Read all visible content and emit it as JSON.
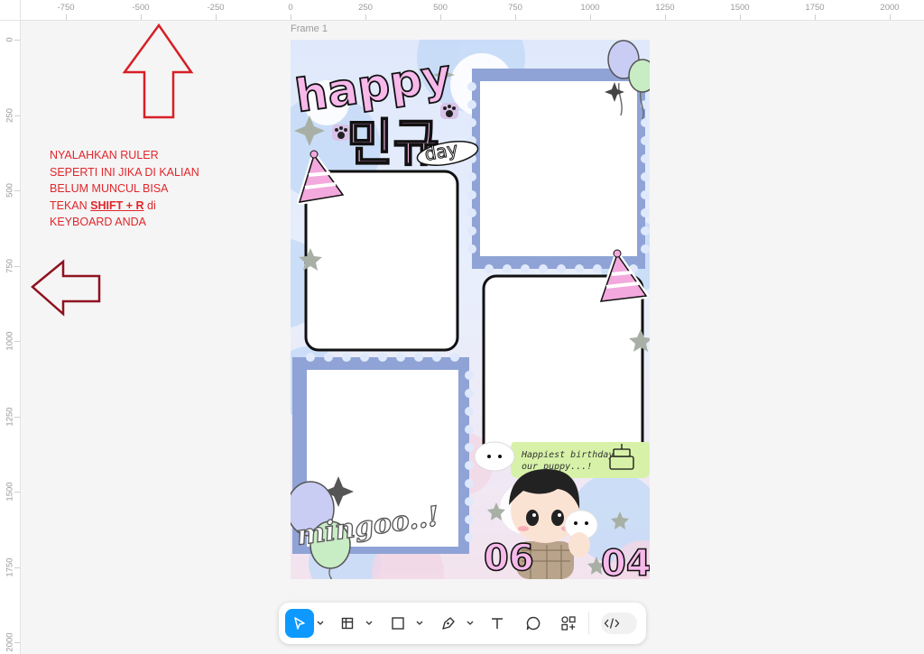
{
  "ruler": {
    "top_labels": [
      "-750",
      "-500",
      "-250",
      "0",
      "250",
      "500",
      "750",
      "1000",
      "1250",
      "1500",
      "1750",
      "2000"
    ],
    "left_labels": [
      "0",
      "250",
      "500",
      "750",
      "1000",
      "1250",
      "1500",
      "1750",
      "2000"
    ]
  },
  "canvas": {
    "frame_label": "Frame 1",
    "note": {
      "line1": "NYALAHKAN RULER",
      "line2": "SEPERTI INI JIKA DI KALIAN",
      "line3": "BELUM MUNCUL BISA",
      "line4_prefix": "TEKAN ",
      "line4_key": "SHIFT + R",
      "line4_suffix": " di",
      "line5": "KEYBOARD ANDA"
    },
    "note_color": "#e0262b",
    "arrow_color": "#d81f26"
  },
  "design": {
    "title_happy": "happy",
    "title_korean": "민규",
    "title_day": "day",
    "speech_line1": "Happiest birthday",
    "speech_line2": "our puppy...!",
    "name_sticker": "mingoo..!",
    "date_month": "06",
    "date_day": "04",
    "title_color": "#f7b8ea",
    "frame_border_color": "#8fa3d6"
  },
  "toolbar": {
    "tools": [
      {
        "name": "move-tool",
        "icon": "cursor-arrow-icon",
        "active": true
      },
      {
        "name": "frame-tool",
        "icon": "frame-icon",
        "active": false
      },
      {
        "name": "shape-tool",
        "icon": "rectangle-icon",
        "active": false
      },
      {
        "name": "pen-tool",
        "icon": "pen-icon",
        "active": false
      },
      {
        "name": "text-tool",
        "icon": "text-icon",
        "active": false
      },
      {
        "name": "comment-tool",
        "icon": "comment-icon",
        "active": false
      },
      {
        "name": "actions-tool",
        "icon": "shapes-plus-icon",
        "active": false
      }
    ],
    "dev_mode_icon": "code-brackets-icon",
    "accent": "#0d99ff"
  }
}
